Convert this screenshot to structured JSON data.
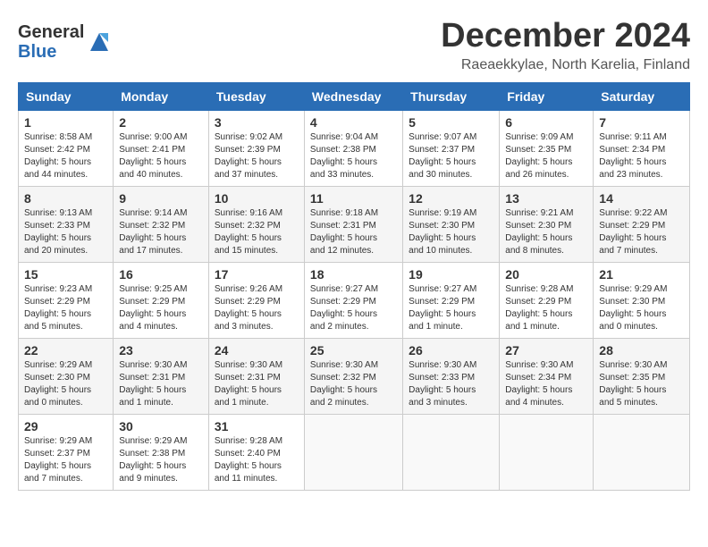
{
  "header": {
    "logo_general": "General",
    "logo_blue": "Blue",
    "month_title": "December 2024",
    "location": "Raeaekkylae, North Karelia, Finland"
  },
  "days_of_week": [
    "Sunday",
    "Monday",
    "Tuesday",
    "Wednesday",
    "Thursday",
    "Friday",
    "Saturday"
  ],
  "weeks": [
    [
      {
        "day": "1",
        "info": "Sunrise: 8:58 AM\nSunset: 2:42 PM\nDaylight: 5 hours\nand 44 minutes."
      },
      {
        "day": "2",
        "info": "Sunrise: 9:00 AM\nSunset: 2:41 PM\nDaylight: 5 hours\nand 40 minutes."
      },
      {
        "day": "3",
        "info": "Sunrise: 9:02 AM\nSunset: 2:39 PM\nDaylight: 5 hours\nand 37 minutes."
      },
      {
        "day": "4",
        "info": "Sunrise: 9:04 AM\nSunset: 2:38 PM\nDaylight: 5 hours\nand 33 minutes."
      },
      {
        "day": "5",
        "info": "Sunrise: 9:07 AM\nSunset: 2:37 PM\nDaylight: 5 hours\nand 30 minutes."
      },
      {
        "day": "6",
        "info": "Sunrise: 9:09 AM\nSunset: 2:35 PM\nDaylight: 5 hours\nand 26 minutes."
      },
      {
        "day": "7",
        "info": "Sunrise: 9:11 AM\nSunset: 2:34 PM\nDaylight: 5 hours\nand 23 minutes."
      }
    ],
    [
      {
        "day": "8",
        "info": "Sunrise: 9:13 AM\nSunset: 2:33 PM\nDaylight: 5 hours\nand 20 minutes."
      },
      {
        "day": "9",
        "info": "Sunrise: 9:14 AM\nSunset: 2:32 PM\nDaylight: 5 hours\nand 17 minutes."
      },
      {
        "day": "10",
        "info": "Sunrise: 9:16 AM\nSunset: 2:32 PM\nDaylight: 5 hours\nand 15 minutes."
      },
      {
        "day": "11",
        "info": "Sunrise: 9:18 AM\nSunset: 2:31 PM\nDaylight: 5 hours\nand 12 minutes."
      },
      {
        "day": "12",
        "info": "Sunrise: 9:19 AM\nSunset: 2:30 PM\nDaylight: 5 hours\nand 10 minutes."
      },
      {
        "day": "13",
        "info": "Sunrise: 9:21 AM\nSunset: 2:30 PM\nDaylight: 5 hours\nand 8 minutes."
      },
      {
        "day": "14",
        "info": "Sunrise: 9:22 AM\nSunset: 2:29 PM\nDaylight: 5 hours\nand 7 minutes."
      }
    ],
    [
      {
        "day": "15",
        "info": "Sunrise: 9:23 AM\nSunset: 2:29 PM\nDaylight: 5 hours\nand 5 minutes."
      },
      {
        "day": "16",
        "info": "Sunrise: 9:25 AM\nSunset: 2:29 PM\nDaylight: 5 hours\nand 4 minutes."
      },
      {
        "day": "17",
        "info": "Sunrise: 9:26 AM\nSunset: 2:29 PM\nDaylight: 5 hours\nand 3 minutes."
      },
      {
        "day": "18",
        "info": "Sunrise: 9:27 AM\nSunset: 2:29 PM\nDaylight: 5 hours\nand 2 minutes."
      },
      {
        "day": "19",
        "info": "Sunrise: 9:27 AM\nSunset: 2:29 PM\nDaylight: 5 hours\nand 1 minute."
      },
      {
        "day": "20",
        "info": "Sunrise: 9:28 AM\nSunset: 2:29 PM\nDaylight: 5 hours\nand 1 minute."
      },
      {
        "day": "21",
        "info": "Sunrise: 9:29 AM\nSunset: 2:30 PM\nDaylight: 5 hours\nand 0 minutes."
      }
    ],
    [
      {
        "day": "22",
        "info": "Sunrise: 9:29 AM\nSunset: 2:30 PM\nDaylight: 5 hours\nand 0 minutes."
      },
      {
        "day": "23",
        "info": "Sunrise: 9:30 AM\nSunset: 2:31 PM\nDaylight: 5 hours\nand 1 minute."
      },
      {
        "day": "24",
        "info": "Sunrise: 9:30 AM\nSunset: 2:31 PM\nDaylight: 5 hours\nand 1 minute."
      },
      {
        "day": "25",
        "info": "Sunrise: 9:30 AM\nSunset: 2:32 PM\nDaylight: 5 hours\nand 2 minutes."
      },
      {
        "day": "26",
        "info": "Sunrise: 9:30 AM\nSunset: 2:33 PM\nDaylight: 5 hours\nand 3 minutes."
      },
      {
        "day": "27",
        "info": "Sunrise: 9:30 AM\nSunset: 2:34 PM\nDaylight: 5 hours\nand 4 minutes."
      },
      {
        "day": "28",
        "info": "Sunrise: 9:30 AM\nSunset: 2:35 PM\nDaylight: 5 hours\nand 5 minutes."
      }
    ],
    [
      {
        "day": "29",
        "info": "Sunrise: 9:29 AM\nSunset: 2:37 PM\nDaylight: 5 hours\nand 7 minutes."
      },
      {
        "day": "30",
        "info": "Sunrise: 9:29 AM\nSunset: 2:38 PM\nDaylight: 5 hours\nand 9 minutes."
      },
      {
        "day": "31",
        "info": "Sunrise: 9:28 AM\nSunset: 2:40 PM\nDaylight: 5 hours\nand 11 minutes."
      },
      {
        "day": "",
        "info": ""
      },
      {
        "day": "",
        "info": ""
      },
      {
        "day": "",
        "info": ""
      },
      {
        "day": "",
        "info": ""
      }
    ]
  ]
}
